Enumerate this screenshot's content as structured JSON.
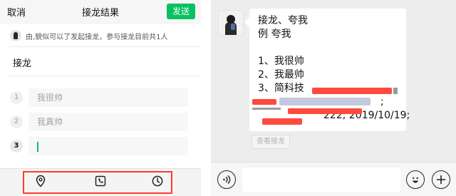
{
  "left": {
    "nav": {
      "cancel_label": "取消",
      "title": "接龙结果",
      "send_label": "发送"
    },
    "initiator_text": "由,貌似可以了发起接龙，参与接龙目前共1人",
    "topic": "接龙",
    "entries": [
      {
        "num": "1",
        "text": "我很帅"
      },
      {
        "num": "2",
        "text": "我真帅"
      },
      {
        "num": "3",
        "text": ""
      }
    ],
    "toolbar_icons": [
      "location-icon",
      "phone-card-icon",
      "clock-icon"
    ]
  },
  "right": {
    "message_lines": [
      "接龙、夸我",
      "例 夸我",
      "",
      "1、我很帅",
      "2、我最帅",
      "3、简科技"
    ],
    "message_tail_a": ";",
    "message_tail_b": "222; 2019/10/19;",
    "view_button_label": "查看接龙",
    "input_icons": [
      "voice-icon",
      "emoji-icon",
      "plus-icon"
    ]
  },
  "colors": {
    "wechat_green": "#07c160",
    "annotation_red": "#ff3b30"
  }
}
